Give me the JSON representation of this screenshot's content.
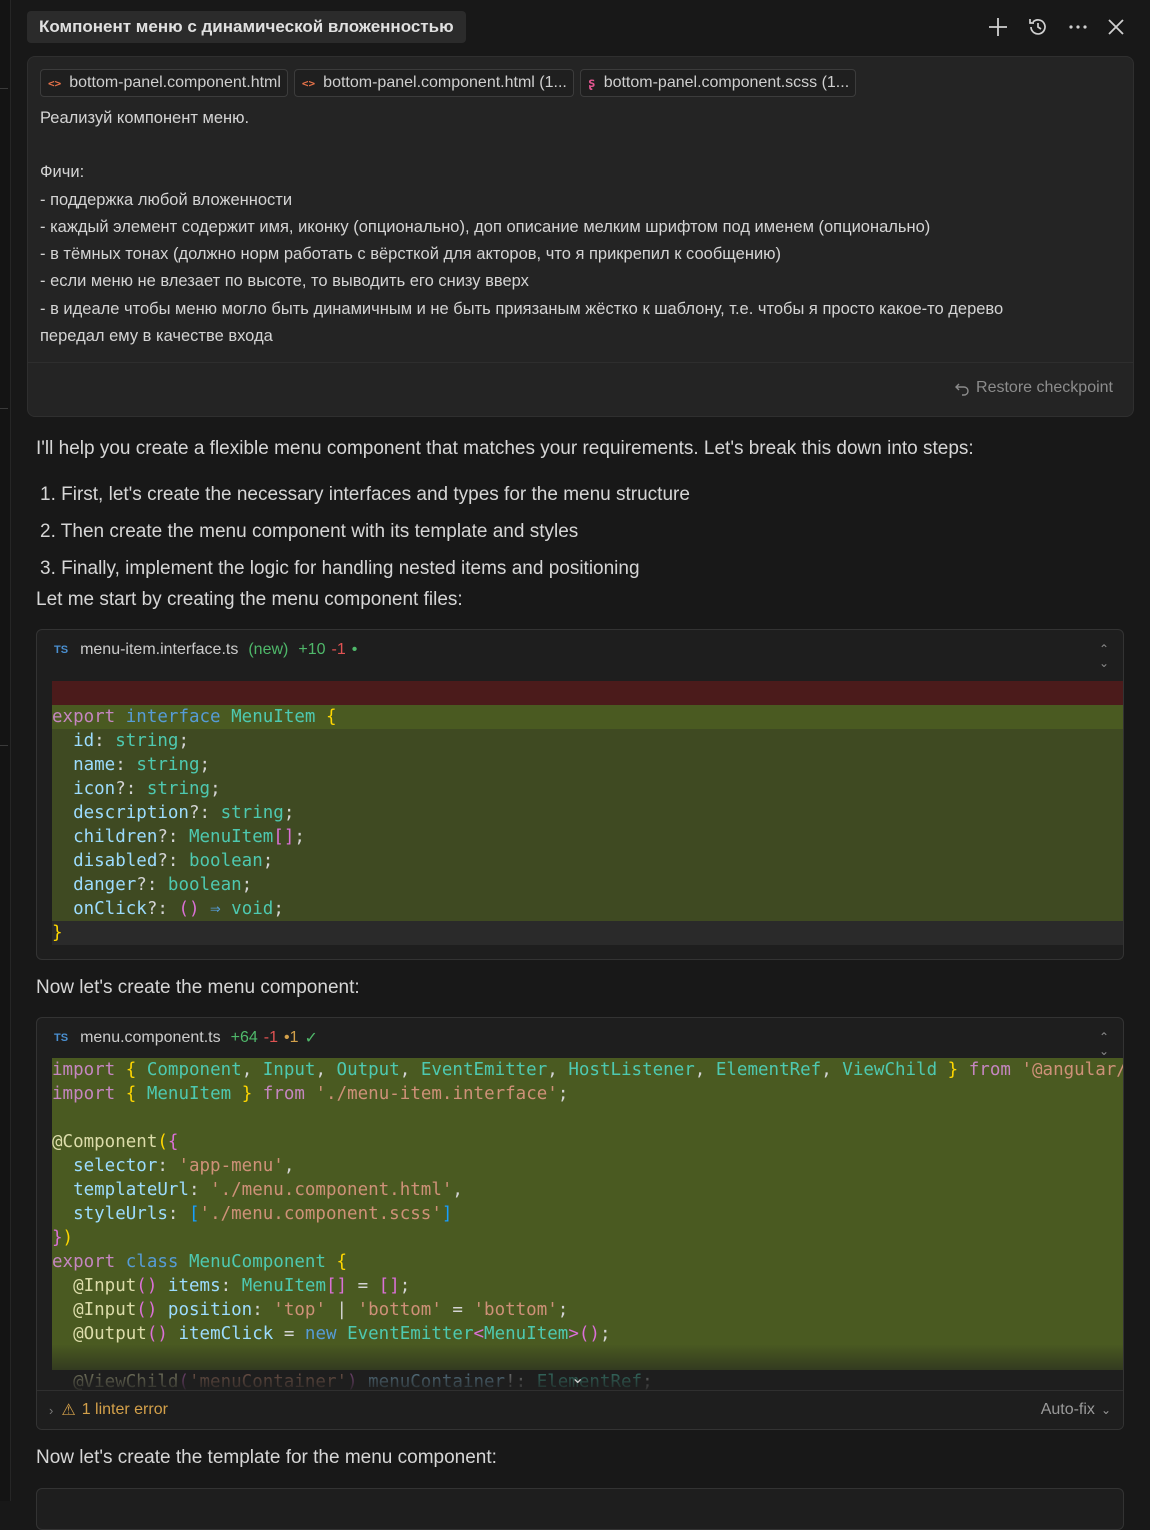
{
  "header": {
    "title": "Компонент меню с динамической вложенностью"
  },
  "user_message": {
    "attachments": [
      {
        "label": "bottom-panel.component.html",
        "icon": "html-icon",
        "color": "#e8734a"
      },
      {
        "label": "bottom-panel.component.html (1...",
        "icon": "html-icon",
        "color": "#e8734a"
      },
      {
        "label": "bottom-panel.component.scss (1...",
        "icon": "scss-icon",
        "color": "#e0558f"
      }
    ],
    "lines": [
      "Реализуй компонент меню.",
      "",
      "Фичи:",
      "- поддержка любой вложенности",
      "- каждый элемент содержит имя, иконку (опционально), доп описание мелким шрифтом под именем (опционально)",
      "- в тёмных тонах (должно норм работать с вёрсткой для акторов, что я прикрепил к сообщению)",
      "- если меню не влезает по высоте, то выводить его снизу вверх",
      "- в идеале чтобы меню могло быть динамичным и не быть приязаным жёстко к шаблону, т.е. чтобы я просто какое-то дерево",
      "передал ему в качестве входа"
    ],
    "restore_label": "Restore checkpoint"
  },
  "assistant": {
    "intro": "I'll help you create a flexible menu component that matches your requirements. Let's break this down into steps:",
    "steps": [
      "1. First, let's create the necessary interfaces and types for the menu structure",
      "2. Then create the menu component with its template and styles",
      "3. Finally, implement the logic for handling nested items and positioning"
    ],
    "start_text": "Let me start by creating the menu component files:",
    "now_component": "Now let's create the menu component:",
    "now_template": "Now let's create the template for the menu component:"
  },
  "code_block_1": {
    "badge": "TS",
    "filename": "menu-item.interface.ts",
    "status": "(new)",
    "added": "+10",
    "removed": "-1",
    "dot": "•"
  },
  "code_block_2": {
    "badge": "TS",
    "filename": "menu.component.ts",
    "added": "+64",
    "removed": "-1",
    "warn": "•1",
    "check": "✓",
    "linter_label": "1 linter error",
    "autofix_label": "Auto-fix"
  },
  "colors": {
    "added_line": "#4a5a21",
    "removed_line": "#4b1b1b",
    "accent_green": "#4fb86a",
    "accent_red": "#e05252",
    "warning": "#d3a04a"
  }
}
